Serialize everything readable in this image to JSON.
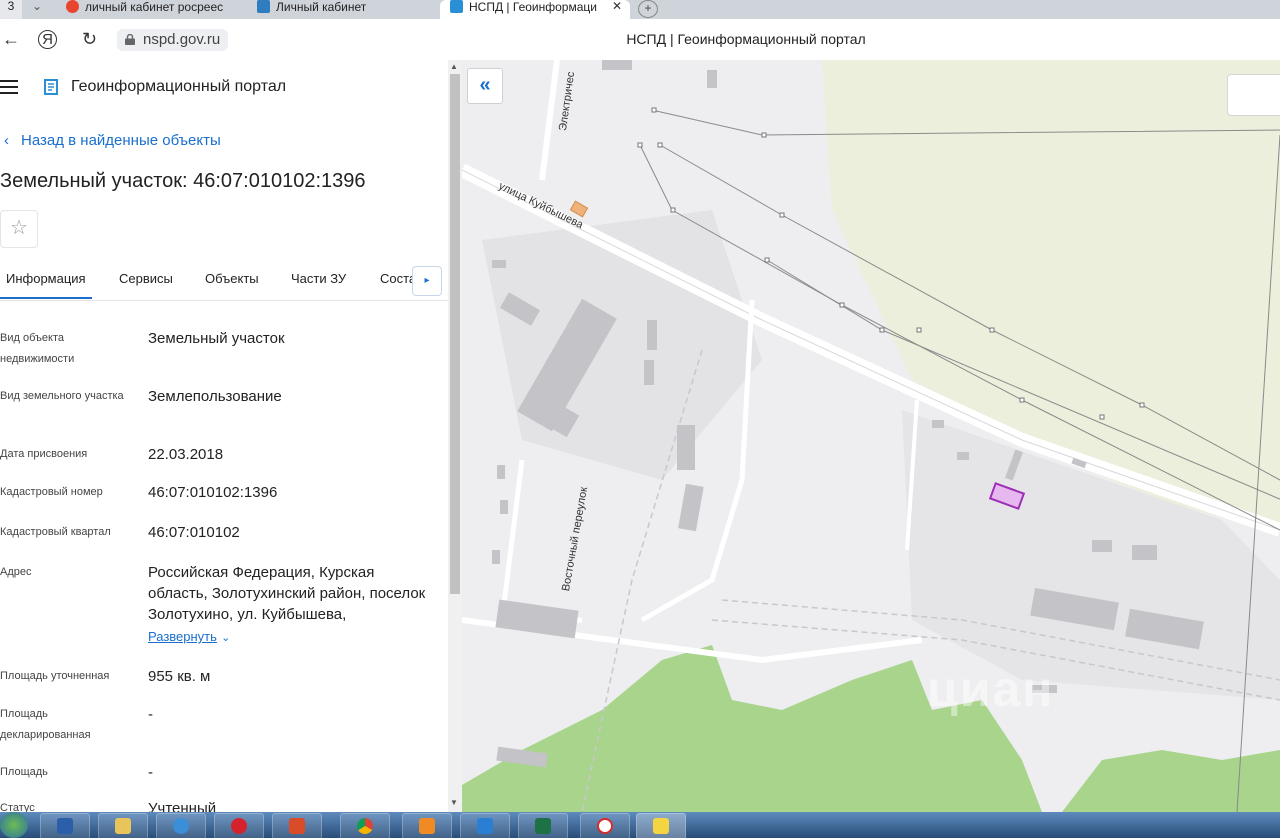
{
  "browser": {
    "tab_count": "3",
    "tabs": [
      {
        "label": "личный кабинет росреес"
      },
      {
        "label": "Личный кабинет"
      },
      {
        "label": "НСПД | Геоинформаци"
      }
    ],
    "url": "nspd.gov.ru",
    "page_title": "НСПД | Геоинформационный портал"
  },
  "panel": {
    "portal_title": "Геоинформационный портал",
    "back_link": "Назад в найденные объекты",
    "object_title": "Земельный участок: 46:07:010102:1396",
    "tabs": [
      "Информация",
      "Сервисы",
      "Объекты",
      "Части ЗУ",
      "Соста"
    ],
    "properties": [
      {
        "key": "Вид объекта недвижимости",
        "value": "Земельный участок"
      },
      {
        "key": "Вид земельного участка",
        "value": "Землепользование"
      },
      {
        "key": "Дата присвоения",
        "value": "22.03.2018"
      },
      {
        "key": "Кадастровый номер",
        "value": "46:07:010102:1396"
      },
      {
        "key": "Кадастровый квартал",
        "value": "46:07:010102"
      },
      {
        "key": "Адрес",
        "value": "Российская Федерация, Курская область, Золотухинский район, поселок Золотухино, ул. Куйбышева,"
      },
      {
        "key": "Площадь уточненная",
        "value": "955 кв. м"
      },
      {
        "key": "Площадь декларированная",
        "value": "-"
      },
      {
        "key": "Площадь",
        "value": "-"
      },
      {
        "key": "Статус",
        "value": "Учтенный"
      }
    ],
    "expand_label": "Развернуть"
  },
  "map": {
    "labels": {
      "street_kuybysheva": "улица Куйбышева",
      "vostochny": "Восточный переулок",
      "elektriches": "Электричес"
    },
    "watermark": "циан",
    "collapse_icon": "double-chevron-left-icon",
    "colors": {
      "background": "#eeeef1",
      "field": "#ecefdc",
      "forest": "#a8d48c",
      "building": "#c4c4c8",
      "parcel_outline": "#9c2fb5",
      "parcel_fill": "#e7b7ef",
      "powerline": "#8a8a8a"
    }
  }
}
